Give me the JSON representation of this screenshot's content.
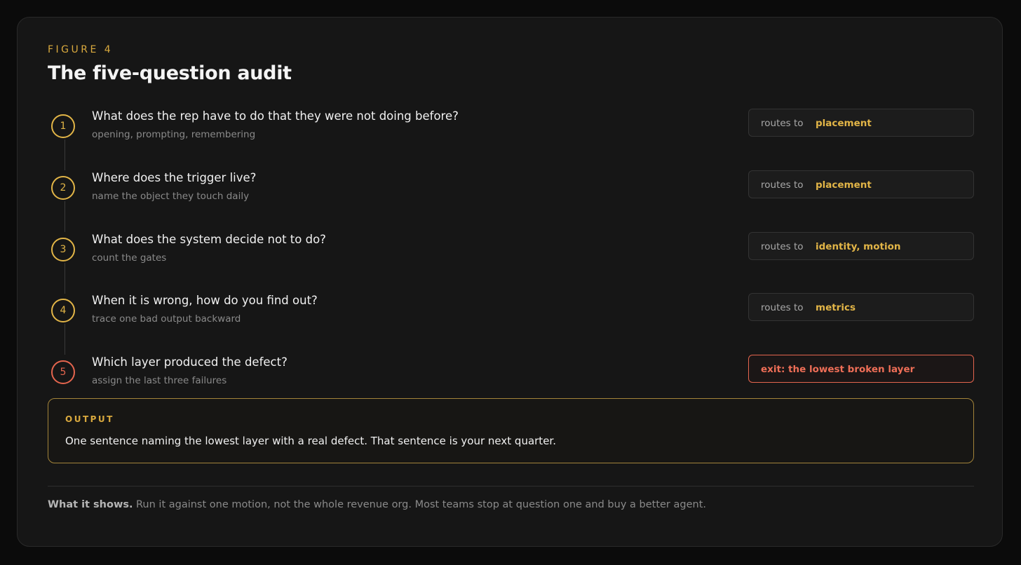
{
  "figure": {
    "eyebrow": "FIGURE 4",
    "title": "The five-question audit"
  },
  "steps": [
    {
      "number": "1",
      "question": "What does the rep have to do that they were not doing before?",
      "subtext": "opening, prompting, remembering",
      "route_label": "routes to",
      "route_target": "placement"
    },
    {
      "number": "2",
      "question": "Where does the trigger live?",
      "subtext": "name the object they touch daily",
      "route_label": "routes to",
      "route_target": "placement"
    },
    {
      "number": "3",
      "question": "What does the system decide not to do?",
      "subtext": "count the gates",
      "route_label": "routes to",
      "route_target": "identity, motion"
    },
    {
      "number": "4",
      "question": "When it is wrong, how do you find out?",
      "subtext": "trace one bad output backward",
      "route_label": "routes to",
      "route_target": "metrics"
    },
    {
      "number": "5",
      "question": "Which layer produced the defect?",
      "subtext": "assign the last three failures",
      "exit_label": "exit: the lowest broken layer"
    }
  ],
  "output": {
    "label": "OUTPUT",
    "text": "One sentence naming the lowest layer with a real defect. That sentence is your next quarter."
  },
  "footer": {
    "label": "What it shows.",
    "text": "Run it against one motion, not the whole revenue org. Most teams stop at question one and buy a better agent."
  },
  "colors": {
    "background": "#0b0b0b",
    "card": "#161616",
    "accent": "#e2b547",
    "exit": "#e4654e",
    "text": "#f1f1f1",
    "muted": "#8a8a8a"
  }
}
